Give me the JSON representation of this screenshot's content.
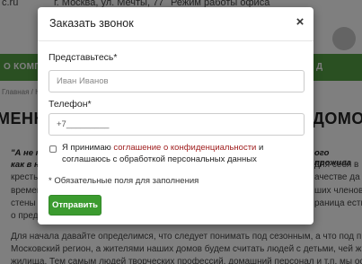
{
  "background": {
    "site_fragment": "c.ru",
    "address": "г. Москва, ул. Мечты, 77",
    "hours": "Режим работы офиса",
    "nav_left": "О КОМПА",
    "nav_right": "Д",
    "crumb_left": "Главная / Новые прожив...",
    "crumb_right": "",
    "title_left": "МЕНН",
    "title_right": "ДОМОВ",
    "quote_line1": "\"А не н",
    "quote_line2": "как в н",
    "quote_right": "ого прожива",
    "side_lines": [
      "для себя в",
      "ачестве да",
      "ших членов",
      "раница есть"
    ],
    "left_fragments": [
      "кресты",
      "времен",
      "стены",
      "о предп"
    ],
    "para_lines": [
      "Для начала давайте определимся, что следует понимать под сезонным, а что под п",
      "Московский регион, а жителями наших домов будем считать людей с детьми, чей жи",
      "жилища. Тем самым людей творческих профессий, домашний персонал и т.п. мы оста"
    ]
  },
  "modal": {
    "title": "Заказать звонок",
    "close_symbol": "×",
    "name_label": "Представьтесь*",
    "name_placeholder": "Иван Иванов",
    "phone_label": "Телефон*",
    "phone_value": "+7_________",
    "agree_prefix": "Я принимаю ",
    "agree_link": "соглашение о конфиденциальности",
    "agree_suffix": " и соглашаюсь с обработкой персональных данных",
    "required_note": "* Обязательные поля для заполнения",
    "submit_label": "Отправить"
  },
  "colors": {
    "brand_green": "#54a044",
    "button_green": "#3b9b2f",
    "link_red": "#a02020"
  }
}
